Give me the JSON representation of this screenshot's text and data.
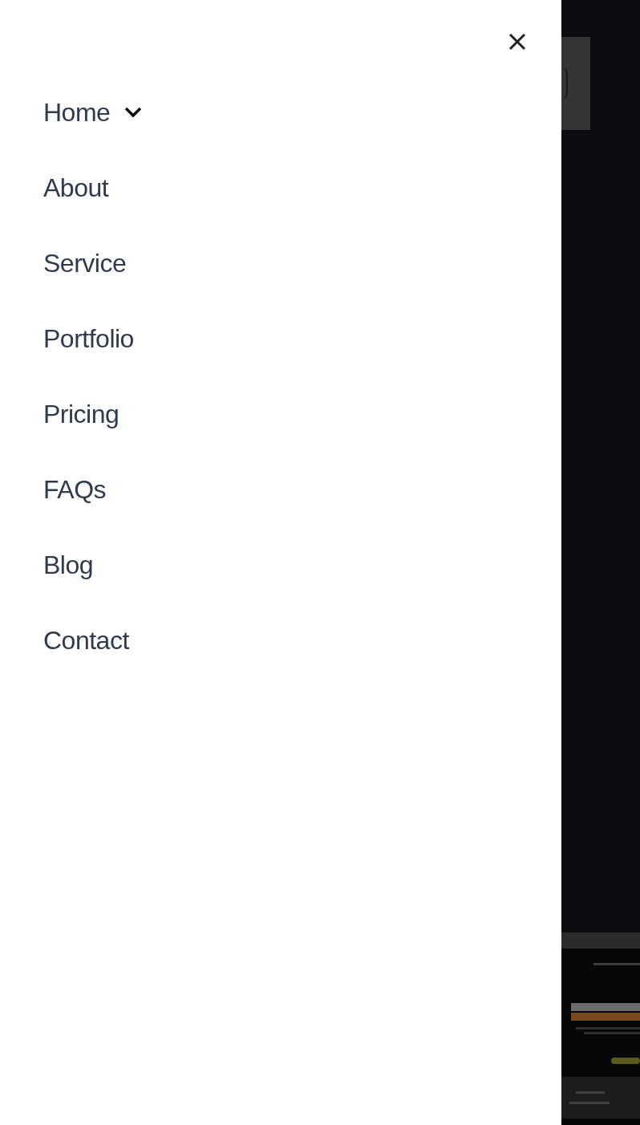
{
  "menu": {
    "items": [
      {
        "label": "Home",
        "expandable": true
      },
      {
        "label": "About",
        "expandable": false
      },
      {
        "label": "Service",
        "expandable": false
      },
      {
        "label": "Portfolio",
        "expandable": false
      },
      {
        "label": "Pricing",
        "expandable": false
      },
      {
        "label": "FAQs",
        "expandable": false
      },
      {
        "label": "Blog",
        "expandable": false
      },
      {
        "label": "Contact",
        "expandable": false
      }
    ]
  }
}
